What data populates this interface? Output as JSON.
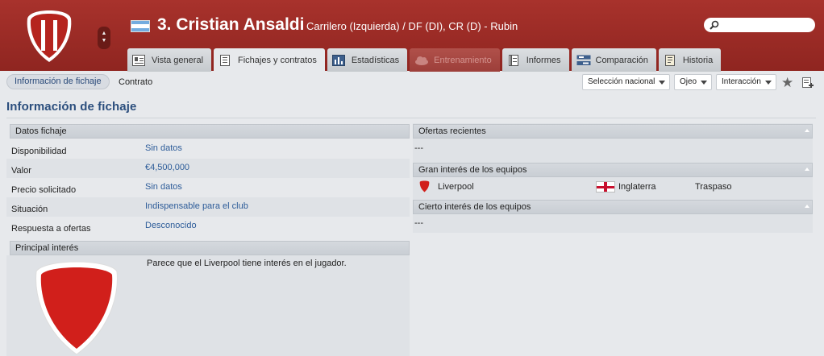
{
  "header": {
    "player_title": "3. Cristian Ansaldi",
    "player_subtitle": "Carrilero (Izquierda) / DF (DI), CR (D) - Rubin",
    "flag": "argentina-flag",
    "colors": {
      "header_red": "#9b2c27",
      "accent_blue": "#2b4e7d",
      "link_blue": "#2d5c99"
    }
  },
  "tabs": [
    {
      "label": "Vista general",
      "icon": "overview-icon"
    },
    {
      "label": "Fichajes y contratos",
      "icon": "document-icon",
      "active": true
    },
    {
      "label": "Estadísticas",
      "icon": "stats-icon"
    },
    {
      "label": "Entrenamiento",
      "icon": "cloud-icon",
      "disabled": true
    },
    {
      "label": "Informes",
      "icon": "report-icon"
    },
    {
      "label": "Comparación",
      "icon": "compare-icon"
    },
    {
      "label": "Historia",
      "icon": "history-icon"
    }
  ],
  "subnav": {
    "active": "Información de fichaje",
    "other": "Contrato",
    "dropdowns": [
      "Selección nacional",
      "Ojeo",
      "Interacción"
    ]
  },
  "page_title": "Información de fichaje",
  "datos_fichaje": {
    "header": "Datos fichaje",
    "rows": [
      {
        "label": "Disponibilidad",
        "value": "Sin datos"
      },
      {
        "label": "Valor",
        "value": "€4,500,000"
      },
      {
        "label": "Precio solicitado",
        "value": "Sin datos"
      },
      {
        "label": "Situación",
        "value": "Indispensable para el club"
      },
      {
        "label": "Respuesta a ofertas",
        "value": "Desconocido"
      }
    ]
  },
  "principal_interes": {
    "header": "Principal interés",
    "text": "Parece que el Liverpool tiene interés en el jugador."
  },
  "ofertas_recientes": {
    "header": "Ofertas recientes",
    "value": "---"
  },
  "gran_interes": {
    "header": "Gran interés de los equipos",
    "club": "Liverpool",
    "country": "Inglaterra",
    "type": "Traspaso"
  },
  "cierto_interes": {
    "header": "Cierto interés de los equipos",
    "value": "---"
  }
}
